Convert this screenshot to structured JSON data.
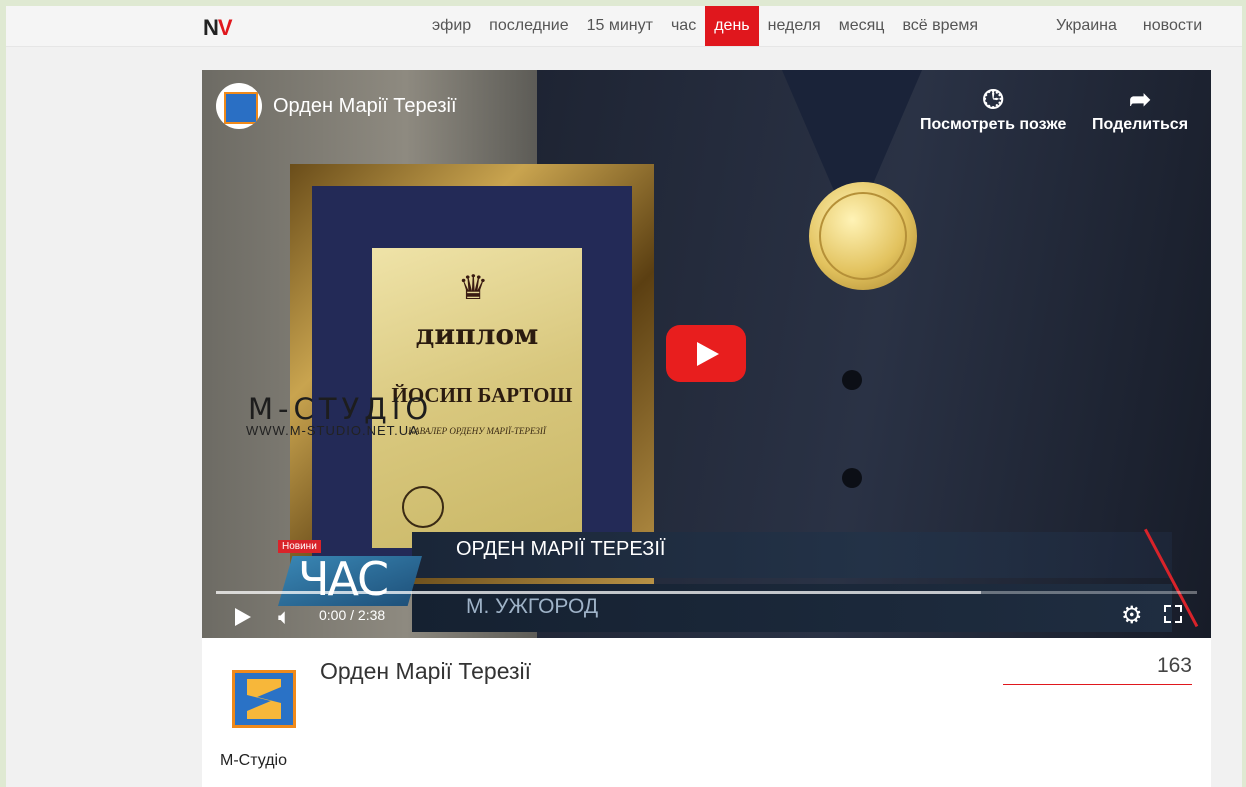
{
  "site": {
    "logo_n": "N",
    "logo_v": "V"
  },
  "nav": {
    "left": [
      "эфир",
      "последние",
      "15 минут",
      "час",
      "день",
      "неделя",
      "месяц",
      "всё время"
    ],
    "active": "день",
    "right": [
      "Украина",
      "новости"
    ]
  },
  "video": {
    "title": "Орден Марії Терезії",
    "watch_later": "Посмотреть позже",
    "share": "Поделиться",
    "diploma_title": "диплом",
    "diploma_name": "ЙОСИП БАРТОШ",
    "diploma_sub": "КАВАЛЕР ОРДЕНУ МАРІЇ-ТЕРЕЗІЇ",
    "watermark": "М-СТУДІО",
    "watermark_url": "WWW.M-STUDIO.NET.UA",
    "news_tag": "Новини",
    "show_name": "ЧАС",
    "ticker_headline": "ОРДЕН МАРІЇ ТЕРЕЗІЇ",
    "ticker_place": "М. УЖГОРОД",
    "time": "0:00 / 2:38",
    "loaded_fraction": 0.78,
    "accent_color": "#e81e1e"
  },
  "info": {
    "heading": "Орден Марії Терезії",
    "views": "163",
    "channel": "М-Студіо"
  },
  "icons": {
    "watch_later": "clock-icon",
    "share": "share-arrow-icon",
    "play": "play-icon",
    "volume": "volume-icon",
    "settings": "gear-icon",
    "fullscreen": "fullscreen-icon"
  }
}
